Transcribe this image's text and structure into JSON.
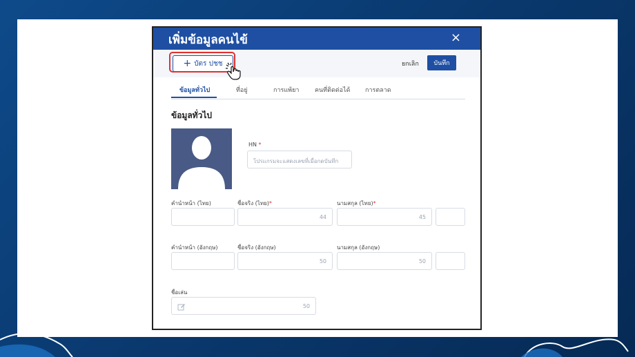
{
  "modal": {
    "title": "เพิ่มข้อมูลคนไข้",
    "close_label": "×"
  },
  "toolbar": {
    "id_card_button": "บัตร ปชช",
    "cancel_label": "ยกเลิก",
    "save_label": "บันทึก"
  },
  "tabs": [
    {
      "label": "ข้อมูลทั่วไป",
      "active": true
    },
    {
      "label": "ที่อยู่",
      "active": false
    },
    {
      "label": "การแพ้ยา",
      "active": false
    },
    {
      "label": "คนที่ติดต่อได้",
      "active": false
    },
    {
      "label": "การตลาด",
      "active": false
    }
  ],
  "section": {
    "title": "ข้อมูลทั่วไป"
  },
  "form": {
    "hn": {
      "label": "HN",
      "required": "*",
      "placeholder": "โปรแกรมจะแสดงเลขที่เมื่อกดบันทึก"
    },
    "title_th": {
      "label": "คำนำหน้า (ไทย)"
    },
    "firstname_th": {
      "label": "ชื่อจริง (ไทย)",
      "required": "*",
      "count": "44"
    },
    "lastname_th": {
      "label": "นามสกุล (ไทย)",
      "required": "*",
      "count": "45"
    },
    "title_en": {
      "label": "คำนำหน้า (อังกฤษ)"
    },
    "firstname_en": {
      "label": "ชื่อจริง (อังกฤษ)",
      "count": "50"
    },
    "lastname_en": {
      "label": "นามสกุล (อังกฤษ)",
      "count": "50"
    },
    "nickname": {
      "label": "ชื่อเล่น",
      "count": "50"
    }
  },
  "colors": {
    "primary": "#1e4fa3",
    "highlight": "#e03030",
    "avatar_bg": "#4a5a86"
  },
  "icons": {
    "close": "close-icon",
    "plus": "plus-icon",
    "pointer": "hand-pointer-icon",
    "edit": "edit-icon",
    "avatar": "person-silhouette-icon"
  }
}
